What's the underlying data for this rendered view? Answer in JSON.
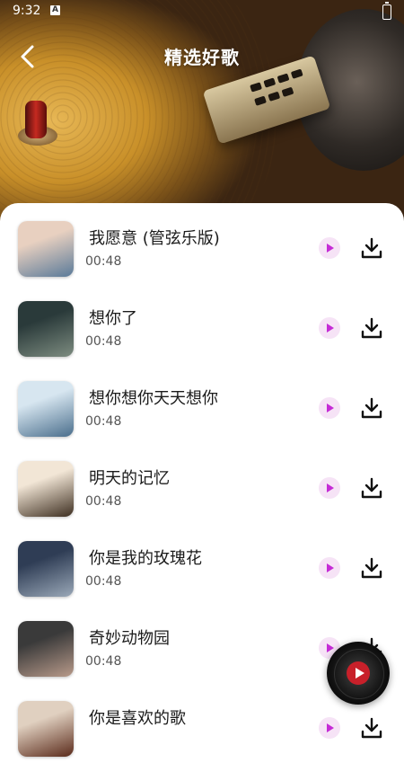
{
  "status_bar": {
    "time": "9:32",
    "notice": "A"
  },
  "header": {
    "title": "精选好歌"
  },
  "songs": [
    {
      "title": "我愿意 (管弦乐版)",
      "duration": "00:48",
      "cover_colors": [
        "#e8d0c0",
        "#5a7a99"
      ]
    },
    {
      "title": "想你了",
      "duration": "00:48",
      "cover_colors": [
        "#2a3a3a",
        "#7d8c80"
      ]
    },
    {
      "title": "想你想你天天想你",
      "duration": "00:48",
      "cover_colors": [
        "#d7e6f0",
        "#4a6e8c"
      ]
    },
    {
      "title": "明天的记忆",
      "duration": "00:48",
      "cover_colors": [
        "#f2e6d6",
        "#3d2e20"
      ]
    },
    {
      "title": "你是我的玫瑰花",
      "duration": "00:48",
      "cover_colors": [
        "#2f3d55",
        "#9aa8b8"
      ]
    },
    {
      "title": "奇妙动物园",
      "duration": "00:48",
      "cover_colors": [
        "#3a3a3a",
        "#b89a8a"
      ]
    },
    {
      "title": "你是喜欢的歌",
      "duration": "",
      "cover_colors": [
        "#e0d0c0",
        "#5a2a1a"
      ]
    }
  ],
  "icons": {
    "back": "chevron-left-icon",
    "play": "play-icon",
    "download": "download-icon",
    "player": "vinyl-player-icon"
  },
  "colors": {
    "accent": "#c52bd6",
    "play_bg": "#f6e3f6"
  }
}
